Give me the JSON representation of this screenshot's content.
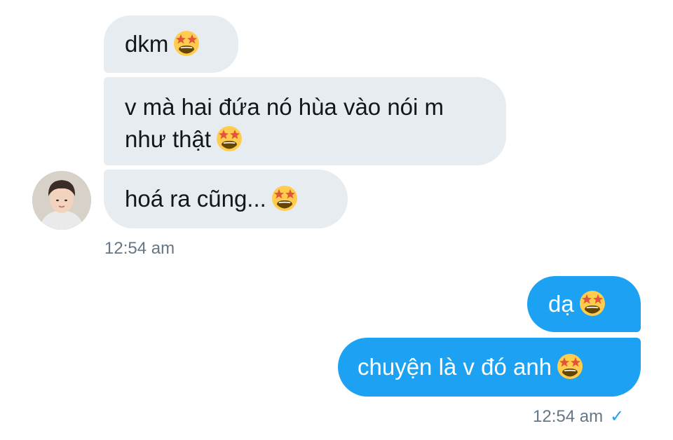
{
  "conversation": {
    "incoming": {
      "messages": [
        {
          "text": "dkm"
        },
        {
          "line1": "v mà hai đứa nó hùa vào nói m",
          "line2": "như thật"
        },
        {
          "text": "hoá ra cũng..."
        }
      ],
      "timestamp": "12:54 am"
    },
    "outgoing": {
      "messages": [
        {
          "text": "dạ"
        },
        {
          "text": "chuyện là v đó anh"
        }
      ],
      "timestamp": "12:54 am",
      "read_mark": "✓"
    }
  },
  "icons": {
    "message_emoji": "star-struck-emoji-icon",
    "sender_avatar": "avatar",
    "sent_status": "check-icon"
  },
  "colors": {
    "incoming_bubble": "#e6ecf0",
    "outgoing_bubble": "#1da1f2",
    "timestamp_text": "#657786",
    "check_mark": "#1da1f2"
  }
}
